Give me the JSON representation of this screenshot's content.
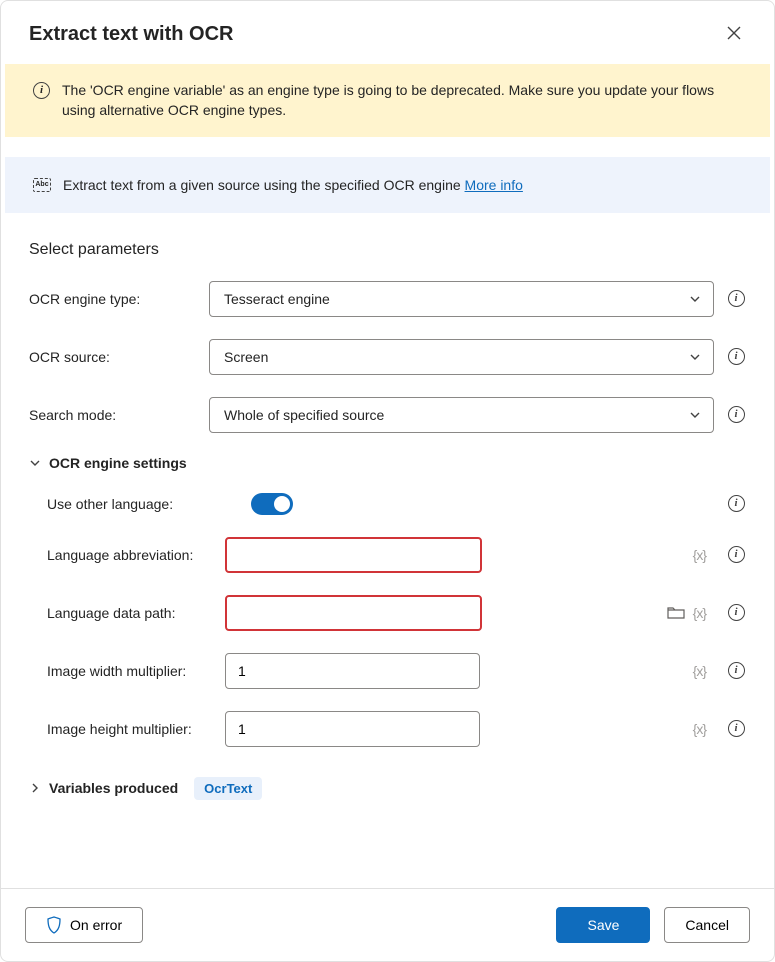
{
  "header": {
    "title": "Extract text with OCR"
  },
  "warning": {
    "text": "The 'OCR engine variable' as an engine type is going to be deprecated.  Make sure you update your flows using alternative OCR engine types."
  },
  "info": {
    "text": "Extract text from a given source using the specified OCR engine ",
    "link": "More info"
  },
  "section": {
    "title": "Select parameters"
  },
  "fields": {
    "engine_type": {
      "label": "OCR engine type:",
      "value": "Tesseract engine"
    },
    "source": {
      "label": "OCR source:",
      "value": "Screen"
    },
    "search_mode": {
      "label": "Search mode:",
      "value": "Whole of specified source"
    }
  },
  "settings": {
    "title": "OCR engine settings",
    "use_other_language": {
      "label": "Use other language:",
      "value": true
    },
    "lang_abbrev": {
      "label": "Language abbreviation:",
      "value": ""
    },
    "lang_data_path": {
      "label": "Language data path:",
      "value": ""
    },
    "width_mult": {
      "label": "Image width multiplier:",
      "value": "1"
    },
    "height_mult": {
      "label": "Image height multiplier:",
      "value": "1"
    }
  },
  "variables": {
    "title": "Variables produced",
    "badge": "OcrText"
  },
  "footer": {
    "on_error": "On error",
    "save": "Save",
    "cancel": "Cancel"
  }
}
